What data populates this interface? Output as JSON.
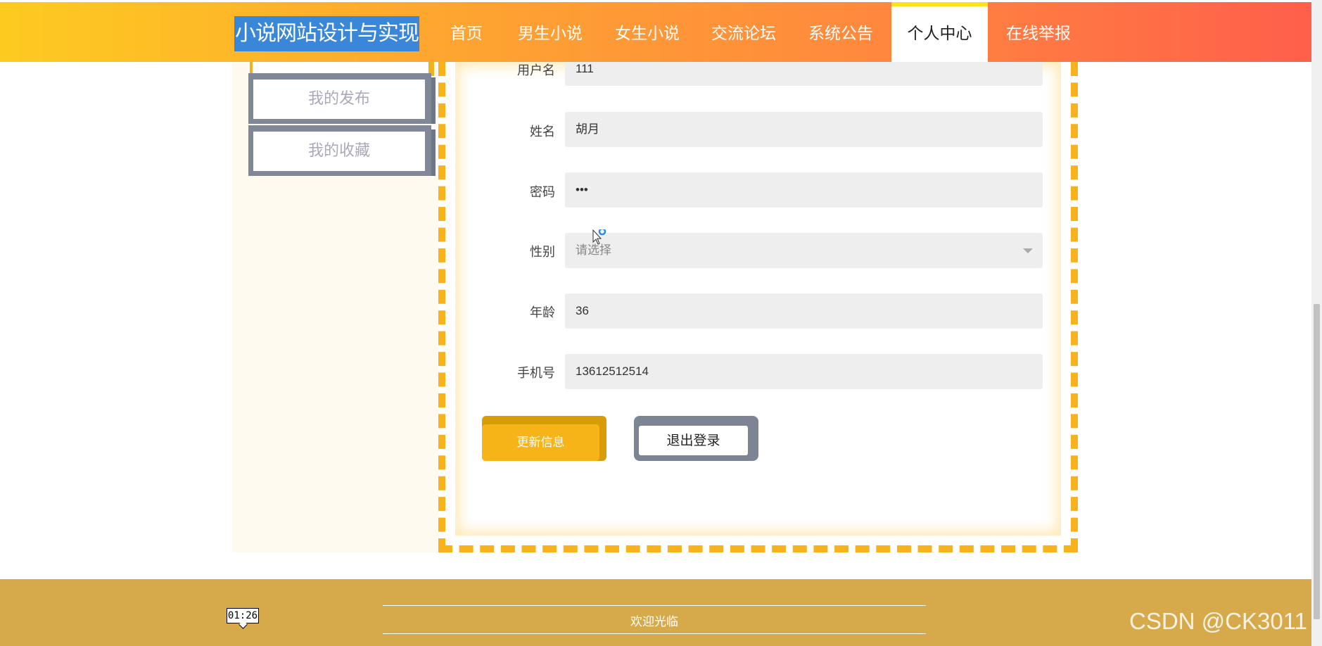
{
  "header": {
    "site_title": "小说网站设计与实现",
    "nav": [
      {
        "label": "首页",
        "active": false
      },
      {
        "label": "男生小说",
        "active": false
      },
      {
        "label": "女生小说",
        "active": false
      },
      {
        "label": "交流论坛",
        "active": false
      },
      {
        "label": "系统公告",
        "active": false
      },
      {
        "label": "个人中心",
        "active": true
      },
      {
        "label": "在线举报",
        "active": false
      }
    ]
  },
  "sidebar": {
    "items": [
      {
        "label": "我的发布"
      },
      {
        "label": "我的收藏"
      }
    ]
  },
  "form": {
    "fields": [
      {
        "label": "用户名",
        "value": "111"
      },
      {
        "label": "姓名",
        "value": "胡月"
      },
      {
        "label": "密码",
        "value": "•••"
      },
      {
        "label": "性别",
        "value": "请选择"
      },
      {
        "label": "年龄",
        "value": "36"
      },
      {
        "label": "手机号",
        "value": "13612512514"
      }
    ],
    "update_label": "更新信息",
    "logout_label": "退出登录"
  },
  "footer": {
    "welcome": "欢迎光临",
    "timer": "01:26",
    "watermark": "CSDN @CK3011"
  },
  "colors": {
    "accent": "#f7b21d",
    "footer_bg": "#d6aa4a",
    "header_start": "#fdcb20",
    "header_end": "#ff5f4b"
  }
}
